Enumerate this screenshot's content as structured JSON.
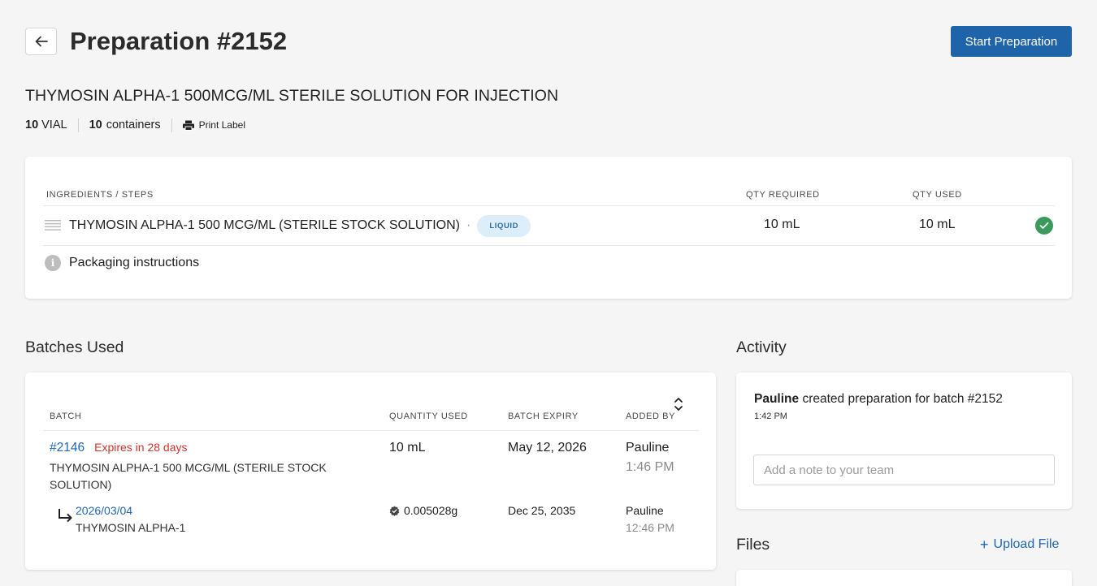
{
  "header": {
    "title": "Preparation #2152",
    "start_button": "Start Preparation",
    "product_name": "THYMOSIN ALPHA-1 500MCG/ML STERILE SOLUTION FOR INJECTION",
    "quantity_value": "10",
    "quantity_unit": "VIAL",
    "containers_value": "10",
    "containers_label": "containers",
    "print_label": "Print Label"
  },
  "ingredients": {
    "headers": {
      "name": "INGREDIENTS / STEPS",
      "qty_required": "QTY REQUIRED",
      "qty_used": "QTY USED"
    },
    "rows": [
      {
        "name": "THYMOSIN ALPHA-1 500 MCG/ML (STERILE STOCK SOLUTION)",
        "separator": "·",
        "badge": "LIQUID",
        "qty_required": "10 mL",
        "qty_used": "10 mL",
        "status": "complete"
      }
    ],
    "packaging": "Packaging instructions"
  },
  "batches": {
    "title": "Batches Used",
    "headers": {
      "batch": "BATCH",
      "quantity": "QUANTITY USED",
      "expiry": "BATCH EXPIRY",
      "added_by": "ADDED BY"
    },
    "rows": [
      {
        "batch_id": "#2146",
        "expires_note": "Expires in 28 days",
        "description": "THYMOSIN ALPHA-1 500 MCG/ML (STERILE STOCK SOLUTION)",
        "quantity": "10 mL",
        "expiry": "May 12, 2026",
        "added_by": "Pauline",
        "time": "1:46 PM"
      },
      {
        "batch_id": "2026/03/04",
        "description": "THYMOSIN ALPHA-1",
        "quantity": "0.005028g",
        "expiry": "Dec 25, 2035",
        "added_by": "Pauline",
        "time": "12:46 PM"
      }
    ]
  },
  "activity": {
    "title": "Activity",
    "entry_user": "Pauline",
    "entry_text": " created preparation for batch #2152",
    "entry_time": "1:42 PM",
    "note_placeholder": "Add a note to your team"
  },
  "files": {
    "title": "Files",
    "upload_label": "Upload File"
  },
  "colors": {
    "primary": "#1f64a8",
    "link": "#2068b0",
    "danger": "#d0342c",
    "success": "#3a9a5c",
    "badge_bg": "#dceef9"
  }
}
